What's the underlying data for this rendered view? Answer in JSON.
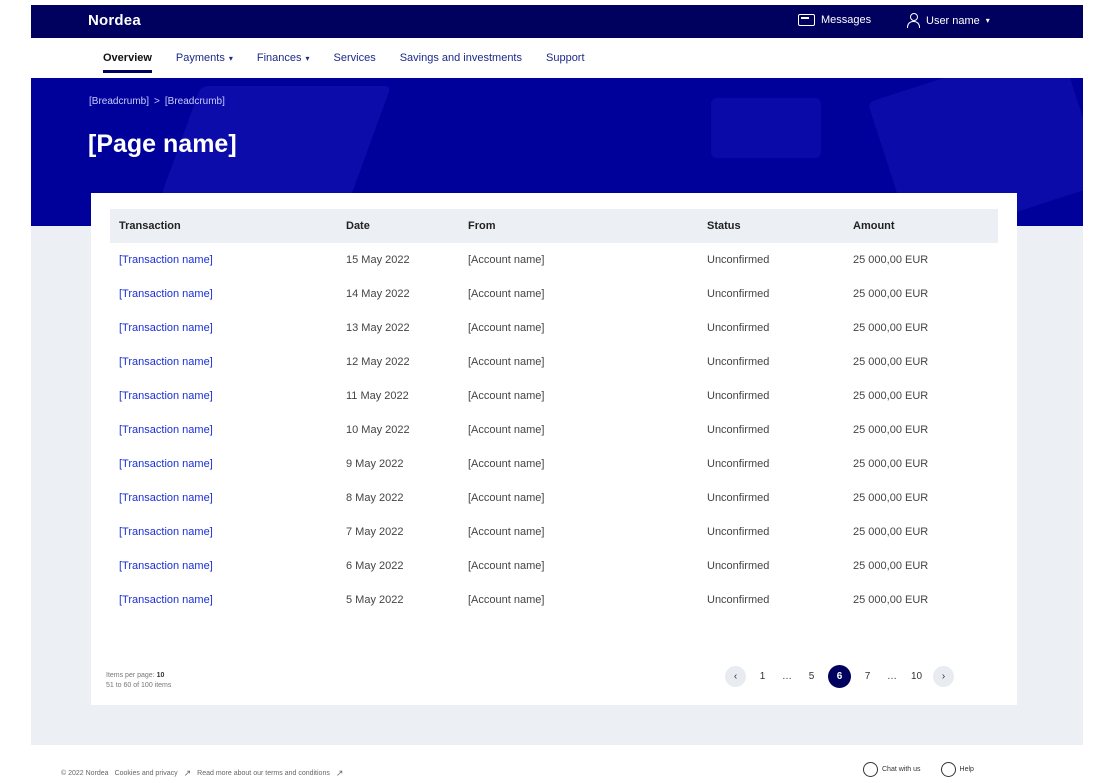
{
  "header": {
    "logo": "Nordea",
    "messages_label": "Messages",
    "user_label": "User name",
    "caret": "▾"
  },
  "nav": [
    {
      "label": "Overview",
      "active": true,
      "dropdown": false
    },
    {
      "label": "Payments",
      "dropdown": true
    },
    {
      "label": "Finances",
      "dropdown": true
    },
    {
      "label": "Services",
      "dropdown": false
    },
    {
      "label": "Savings and investments",
      "dropdown": false
    },
    {
      "label": "Support",
      "dropdown": false
    }
  ],
  "breadcrumb": {
    "first": "[Breadcrumb]",
    "separator": ">",
    "second": "[Breadcrumb]"
  },
  "page_title": "[Page name]",
  "table": {
    "headers": {
      "transaction": "Transaction",
      "date": "Date",
      "from": "From",
      "status": "Status",
      "amount": "Amount"
    },
    "rows": [
      {
        "transaction": "[Transaction name]",
        "date": "15 May 2022",
        "from": "[Account name]",
        "status": "Unconfirmed",
        "amount": "25 000,00 EUR"
      },
      {
        "transaction": "[Transaction name]",
        "date": "14 May 2022",
        "from": "[Account name]",
        "status": "Unconfirmed",
        "amount": "25 000,00 EUR"
      },
      {
        "transaction": "[Transaction name]",
        "date": "13 May 2022",
        "from": "[Account name]",
        "status": "Unconfirmed",
        "amount": "25 000,00 EUR"
      },
      {
        "transaction": "[Transaction name]",
        "date": "12 May 2022",
        "from": "[Account name]",
        "status": "Unconfirmed",
        "amount": "25 000,00 EUR"
      },
      {
        "transaction": "[Transaction name]",
        "date": "11 May 2022",
        "from": "[Account name]",
        "status": "Unconfirmed",
        "amount": "25 000,00 EUR"
      },
      {
        "transaction": "[Transaction name]",
        "date": "10 May 2022",
        "from": "[Account name]",
        "status": "Unconfirmed",
        "amount": "25 000,00 EUR"
      },
      {
        "transaction": "[Transaction name]",
        "date": "9 May 2022",
        "from": "[Account name]",
        "status": "Unconfirmed",
        "amount": "25 000,00 EUR"
      },
      {
        "transaction": "[Transaction name]",
        "date": "8 May 2022",
        "from": "[Account name]",
        "status": "Unconfirmed",
        "amount": "25 000,00 EUR"
      },
      {
        "transaction": "[Transaction name]",
        "date": "7 May 2022",
        "from": "[Account name]",
        "status": "Unconfirmed",
        "amount": "25 000,00 EUR"
      },
      {
        "transaction": "[Transaction name]",
        "date": "6 May 2022",
        "from": "[Account name]",
        "status": "Unconfirmed",
        "amount": "25 000,00 EUR"
      },
      {
        "transaction": "[Transaction name]",
        "date": "5 May 2022",
        "from": "[Account name]",
        "status": "Unconfirmed",
        "amount": "25 000,00 EUR"
      }
    ]
  },
  "items_per_page": {
    "label": "Items per page:",
    "value": "10",
    "range": "51 to 60 of 100 items"
  },
  "pagination": {
    "prev": "‹",
    "next": "›",
    "pages": [
      "1",
      "…",
      "5",
      "6",
      "7",
      "…",
      "10"
    ],
    "current": "6"
  },
  "footer": {
    "copyright": "© 2022 Nordea",
    "cookies_link": "Cookies and privacy",
    "accessibility_link": "Read more about our terms and conditions",
    "ext_icon": "↗",
    "chat_label": "Chat with us",
    "help_label": "Help"
  },
  "colors": {
    "brand": "#00005e",
    "hero": "#00009b",
    "link": "#1a2fd4",
    "background": "#eceff3"
  }
}
